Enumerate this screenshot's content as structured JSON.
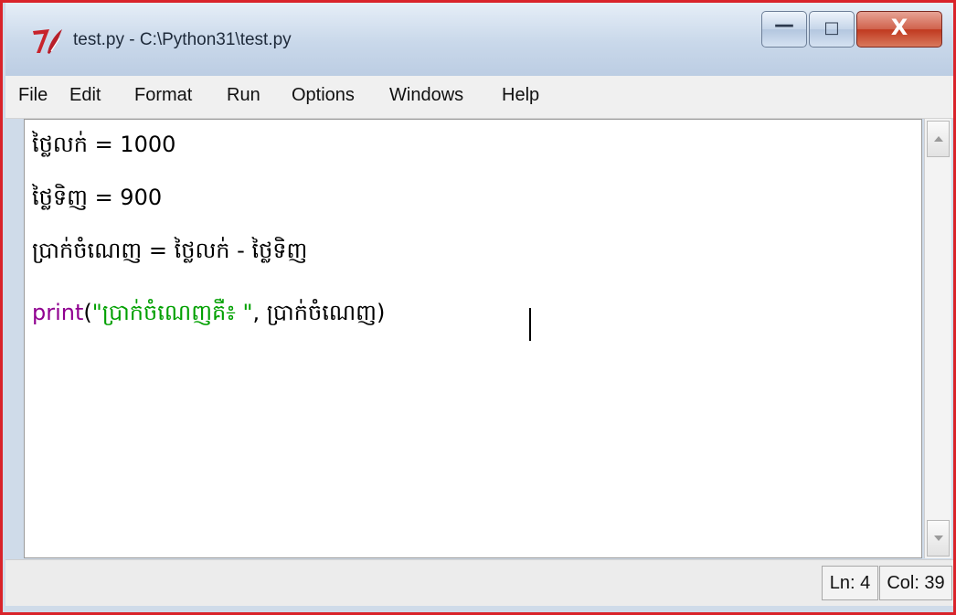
{
  "window": {
    "title": "test.py - C:\\Python31\\test.py",
    "controls": {
      "minimize": "—",
      "maximize": "□",
      "close": "X"
    }
  },
  "menu": [
    "File",
    "Edit",
    "Format",
    "Run",
    "Options",
    "Windows",
    "Help"
  ],
  "editor": {
    "lines": [
      "ថ្លៃលក់ = 1000",
      "ថ្លៃទិញ = 900",
      "ប្រាក់ចំណេញ = ថ្លៃលក់ - ថ្លៃទិញ"
    ],
    "line4": {
      "builtin": "print",
      "open": "(",
      "string": "\"ប្រាក់ចំណេញគឺ៖ \"",
      "rest": ", ប្រាក់ចំណេញ)"
    }
  },
  "status": {
    "line": "Ln: 4",
    "column": "Col: 39"
  },
  "colors": {
    "builtin": "#900090",
    "string": "#00a000",
    "window_border": "#d9232a"
  },
  "icons": {
    "app": "tk-feather-icon",
    "scroll_up": "scroll-up-arrow-icon",
    "scroll_down": "scroll-down-arrow-icon"
  }
}
